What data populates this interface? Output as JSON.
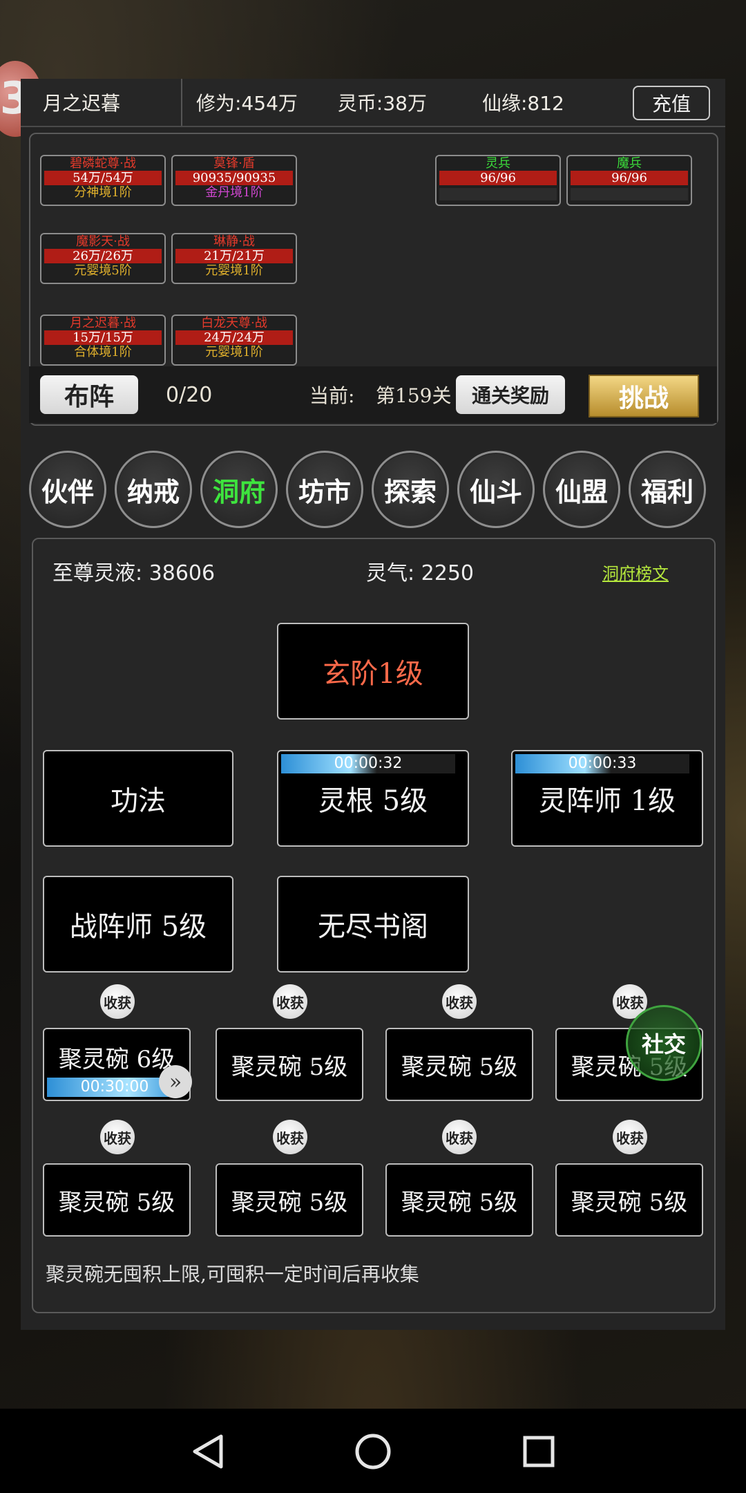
{
  "header": {
    "player_name": "月之迟暮",
    "cultivation": "修为:454万",
    "spirit_coins": "灵币:38万",
    "fate": "仙缘:812",
    "recharge_label": "充值"
  },
  "formation": {
    "units_left": [
      {
        "name": "碧磷蛇尊·战",
        "hp": "54万/54万",
        "realm": "分神境1阶",
        "realm_color": "#e0b02c"
      },
      {
        "name": "莫锋·盾",
        "hp": "90935/90935",
        "realm": "金丹境1阶",
        "realm_color": "#d147d1"
      },
      {
        "name": "魔影天·战",
        "hp": "26万/26万",
        "realm": "元婴境5阶",
        "realm_color": "#e0b02c"
      },
      {
        "name": "琳静·战",
        "hp": "21万/21万",
        "realm": "元婴境1阶",
        "realm_color": "#e0b02c"
      },
      {
        "name": "月之迟暮·战",
        "hp": "15万/15万",
        "realm": "合体境1阶",
        "realm_color": "#e0b02c"
      },
      {
        "name": "白龙天尊·战",
        "hp": "24万/24万",
        "realm": "元婴境1阶",
        "realm_color": "#e0b02c"
      }
    ],
    "units_right": [
      {
        "name": "灵兵",
        "hp": "96/96"
      },
      {
        "name": "魔兵",
        "hp": "96/96"
      }
    ],
    "arrange_label": "布阵",
    "slots": "0/20",
    "current_label": "当前:",
    "current_stage": "第159关",
    "clear_reward_label": "通关奖励",
    "challenge_label": "挑战"
  },
  "tabs": [
    {
      "label": "伙伴",
      "active": false
    },
    {
      "label": "纳戒",
      "active": false
    },
    {
      "label": "洞府",
      "active": true
    },
    {
      "label": "坊市",
      "active": false
    },
    {
      "label": "探索",
      "active": false
    },
    {
      "label": "仙斗",
      "active": false
    },
    {
      "label": "仙盟",
      "active": false
    },
    {
      "label": "福利",
      "active": false
    }
  ],
  "cave": {
    "supreme_liquid": "至尊灵液: 38606",
    "spirit_qi": "灵气: 2250",
    "ranking_link": "洞府榜文",
    "main_building": "玄阶1级",
    "buildings": [
      {
        "label": "功法",
        "timer": ""
      },
      {
        "label": "灵根 5级",
        "timer": "00:00:32"
      },
      {
        "label": "灵阵师 1级",
        "timer": "00:00:33"
      },
      {
        "label": "战阵师 5级",
        "timer": ""
      },
      {
        "label": "无尽书阁",
        "timer": ""
      }
    ],
    "harvest_label": "收获",
    "bowls_row1": [
      {
        "label": "聚灵碗 6级",
        "timer": "00:30:00"
      },
      {
        "label": "聚灵碗 5级",
        "timer": ""
      },
      {
        "label": "聚灵碗 5级",
        "timer": ""
      },
      {
        "label": "聚灵碗 5级",
        "timer": ""
      }
    ],
    "bowls_row2": [
      {
        "label": "聚灵碗 5级"
      },
      {
        "label": "聚灵碗 5级"
      },
      {
        "label": "聚灵碗 5级"
      },
      {
        "label": "聚灵碗 5级"
      }
    ],
    "note": "聚灵碗无囤积上限,可囤积一定时间后再收集"
  },
  "social_label": "社交",
  "colors": {
    "active_tab": "#3ee43e",
    "main_building_text": "#ff6a4a",
    "hp_bar": "#b01d16",
    "link": "#b5e83c"
  },
  "icons": [
    "back-icon",
    "home-icon",
    "recents-icon",
    "double-chevron-icon"
  ]
}
